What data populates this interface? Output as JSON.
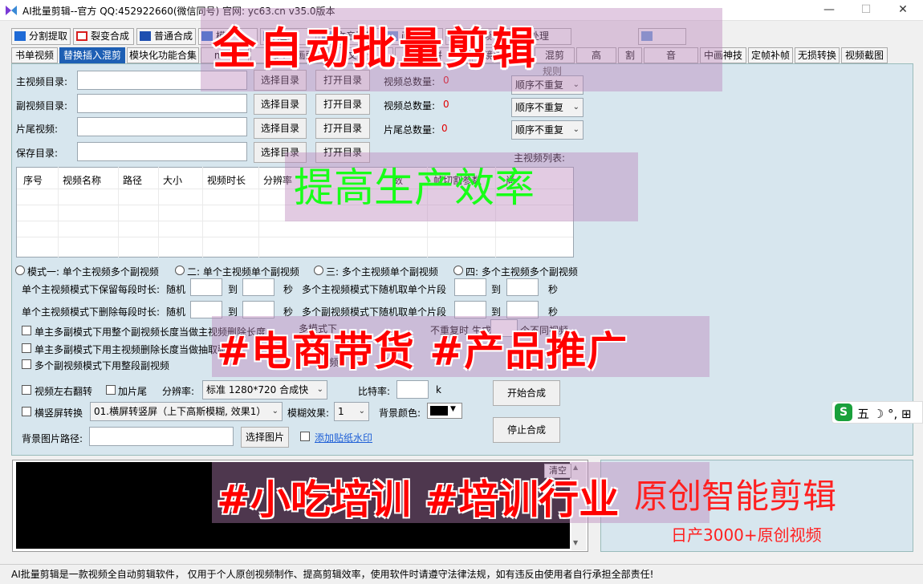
{
  "window": {
    "title": "AI批量剪辑--官方  QQ:452922660(微信同号)  官网: yc63.cn    v35.0版本",
    "min": "—",
    "max": "☐",
    "close": "✕"
  },
  "top_tabs": [
    {
      "label": "分割提取",
      "icon_color": "#1e6ad6"
    },
    {
      "label": "裂变合成",
      "icon_color": "#d81e1e"
    },
    {
      "label": "普通合成",
      "icon_color": "#1e4fb0"
    },
    {
      "label": "模",
      "icon_color": "#1e6ad6"
    },
    {
      "label": "超级",
      "icon_color": "#1e6ad6"
    },
    {
      "label": "文音互转",
      "icon_color": "#1e6ad6"
    },
    {
      "label": "画截",
      "icon_color": "#1e6ad6"
    },
    {
      "label": "转视频",
      "icon_color": "#1e6ad6"
    },
    {
      "label": "处理",
      "icon_color": "#1e6ad6"
    },
    {
      "label": "",
      "icon_color": "#1e6ad6"
    }
  ],
  "sub_tabs": [
    {
      "label": "书单视频"
    },
    {
      "label": "替换插入混剪"
    },
    {
      "label": "模块化功能合集"
    },
    {
      "label": "mov"
    },
    {
      "label": "mp4与画面"
    },
    {
      "label": "文件分"
    },
    {
      "label": "格拼"
    },
    {
      "label": "镜头切片"
    },
    {
      "label": "混剪"
    },
    {
      "label": "高"
    },
    {
      "label": "割"
    },
    {
      "label": "音"
    },
    {
      "label": "中画神技"
    },
    {
      "label": "定帧补帧"
    },
    {
      "label": "无损转换"
    },
    {
      "label": "视频截图"
    }
  ],
  "form": {
    "main_dir_label": "主视频目录:",
    "sub_dir_label": "副视频目录:",
    "tail_label": "片尾视频:",
    "save_label": "保存目录:",
    "choose_dir": "选择目录",
    "open_dir": "打开目录",
    "total_label": "视频总数量:",
    "tail_total_label": "片尾总数量:",
    "main_count": "0",
    "sub_count": "0",
    "tail_count": "0",
    "rule_label": "规则",
    "order_options": [
      "顺序不重复",
      "顺序不重复",
      "顺序不重复"
    ],
    "main_list_label": "主视频列表:"
  },
  "table": {
    "columns": [
      "序号",
      "视频名称",
      "路径",
      "大小",
      "视频时长",
      "分辨率",
      "数",
      "帧切割参数",
      "尚"
    ]
  },
  "modes": {
    "options": [
      "模式一: 单个主视频多个副视频",
      "二: 单个主视频单个副视频",
      "三: 多个主视频单个副视频",
      "四: 多个主视频多个副视频"
    ],
    "keep_label": "单个主视频模式下保留每段时长:",
    "delete_label": "单个主视频模式下删除每段时长:",
    "random": "随机",
    "to": "到",
    "sec": "秒",
    "multi_main_label": "多个主视频模式下随机取单个片段",
    "multi_sub_label": "多个副视频模式下随机取单个片段"
  },
  "checks": {
    "c1": "单主多副模式下用整个副视频长度当做主视频删除长度",
    "c2": "单主多副模式下用主视频删除长度当做抽取副",
    "c3": "多个副视频模式下用整段副视频",
    "c4_tail": "多模式下",
    "c4_mid": "不重复时 生成",
    "c4_end": "个不同视频",
    "c5_tail": "频",
    "c6_tail": "整"
  },
  "output": {
    "flip_label": "视频左右翻转",
    "add_tail_label": "加片尾",
    "resolution_label": "分辨率:",
    "resolution_value": "标准 1280*720 合成快",
    "bitrate_label": "比特率:",
    "bitrate_unit": "k",
    "orient_label": "横竖屏转换",
    "orient_value": "01.横屏转竖屏（上下高斯模糊, 效果1）",
    "blur_label": "模糊效果:",
    "blur_value": "1",
    "bg_color_label": "背景颜色:",
    "bg_image_label": "背景图片路径:",
    "choose_image": "选择图片",
    "watermark_link": "添加贴纸水印",
    "start_button": "开始合成",
    "stop_button": "停止合成"
  },
  "log": {
    "clear_button": "清空"
  },
  "status_bar": "AI批量剪辑是一款视频全自动剪辑软件，  仅用于个人原创视频制作、提高剪辑效率，使用软件时请遵守法律法规，如有违反由使用者自行承担全部责任!",
  "overlays": {
    "headline": "全自动批量剪辑",
    "efficiency": "提高生产效率",
    "ecommerce": "#电商带货   #产品推广",
    "training": "#小吃培训   #培训行业",
    "promo_line1": "原创智能剪辑",
    "promo_line2": "日产3000+原创视频"
  },
  "ime": {
    "logo": "S",
    "text": "五 ☽ °, ⊞"
  },
  "colors": {
    "accent": "#1e5fb4",
    "panel": "#d7e6ee",
    "count_red": "#e00000",
    "overlay_red": "#ff0000",
    "overlay_green": "#18ff18"
  }
}
